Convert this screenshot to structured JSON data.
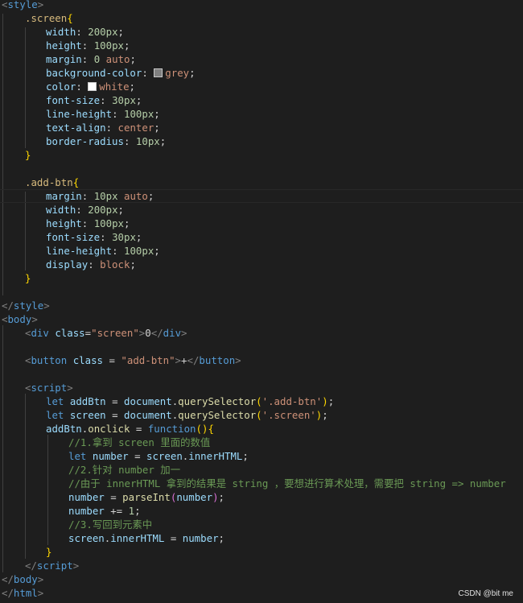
{
  "editor": {
    "theme_colors": {
      "background": "#1e1e1e",
      "tag": "#569cd6",
      "selector": "#d7ba7d",
      "property": "#9cdcfe",
      "number": "#b5cea8",
      "string": "#ce9178",
      "function": "#dcdcaa",
      "comment": "#6a9955"
    },
    "swatch_grey": "#808080",
    "swatch_white": "#ffffff",
    "code": {
      "style_open_tag": "style",
      "screen_selector": ".screen",
      "screen_rules": [
        {
          "prop": "width",
          "num": "200px",
          "val": ""
        },
        {
          "prop": "height",
          "num": "100px",
          "val": ""
        },
        {
          "prop": "margin",
          "num": "0",
          "val": "auto"
        },
        {
          "prop": "background-color",
          "num": "",
          "val": "grey"
        },
        {
          "prop": "color",
          "num": "",
          "val": "white"
        },
        {
          "prop": "font-size",
          "num": "30px",
          "val": ""
        },
        {
          "prop": "line-height",
          "num": "100px",
          "val": ""
        },
        {
          "prop": "text-align",
          "num": "",
          "val": "center"
        },
        {
          "prop": "border-radius",
          "num": "10px",
          "val": ""
        }
      ],
      "addbtn_selector": ".add-btn",
      "addbtn_rules": [
        {
          "prop": "margin",
          "num": "10px",
          "val": "auto"
        },
        {
          "prop": "width",
          "num": "200px",
          "val": ""
        },
        {
          "prop": "height",
          "num": "100px",
          "val": ""
        },
        {
          "prop": "font-size",
          "num": "30px",
          "val": ""
        },
        {
          "prop": "line-height",
          "num": "100px",
          "val": ""
        },
        {
          "prop": "display",
          "num": "",
          "val": "block"
        }
      ],
      "style_close_tag": "style",
      "body_tag": "body",
      "div_tag": "div",
      "class_attr": "class",
      "div_class_value": "\"screen\"",
      "div_text": "0",
      "button_tag": "button",
      "button_class_value": "\"add-btn\"",
      "button_text": "+",
      "script_tag": "script",
      "let_kw": "let",
      "addBtn_var": "addBtn",
      "screen_var": "screen",
      "document_var": "document",
      "querySelector_fn": "querySelector",
      "addbtn_string": "'.add-btn'",
      "screen_string": "'.screen'",
      "onclick_prop": "onclick",
      "function_kw": "function",
      "comment1": "//1.拿到 screen 里面的数值",
      "number_var": "number",
      "innerHTML_prop": "innerHTML",
      "comment2": "//2.针对 number 加一",
      "comment3": "//由于 innerHTML 拿到的结果是 string ，要想进行算术处理，需要把 string => number",
      "parseInt_fn": "parseInt",
      "one_num": "1",
      "comment4": "//3.写回到元素中",
      "html_tag": "html"
    }
  },
  "watermark": "CSDN @bit me"
}
